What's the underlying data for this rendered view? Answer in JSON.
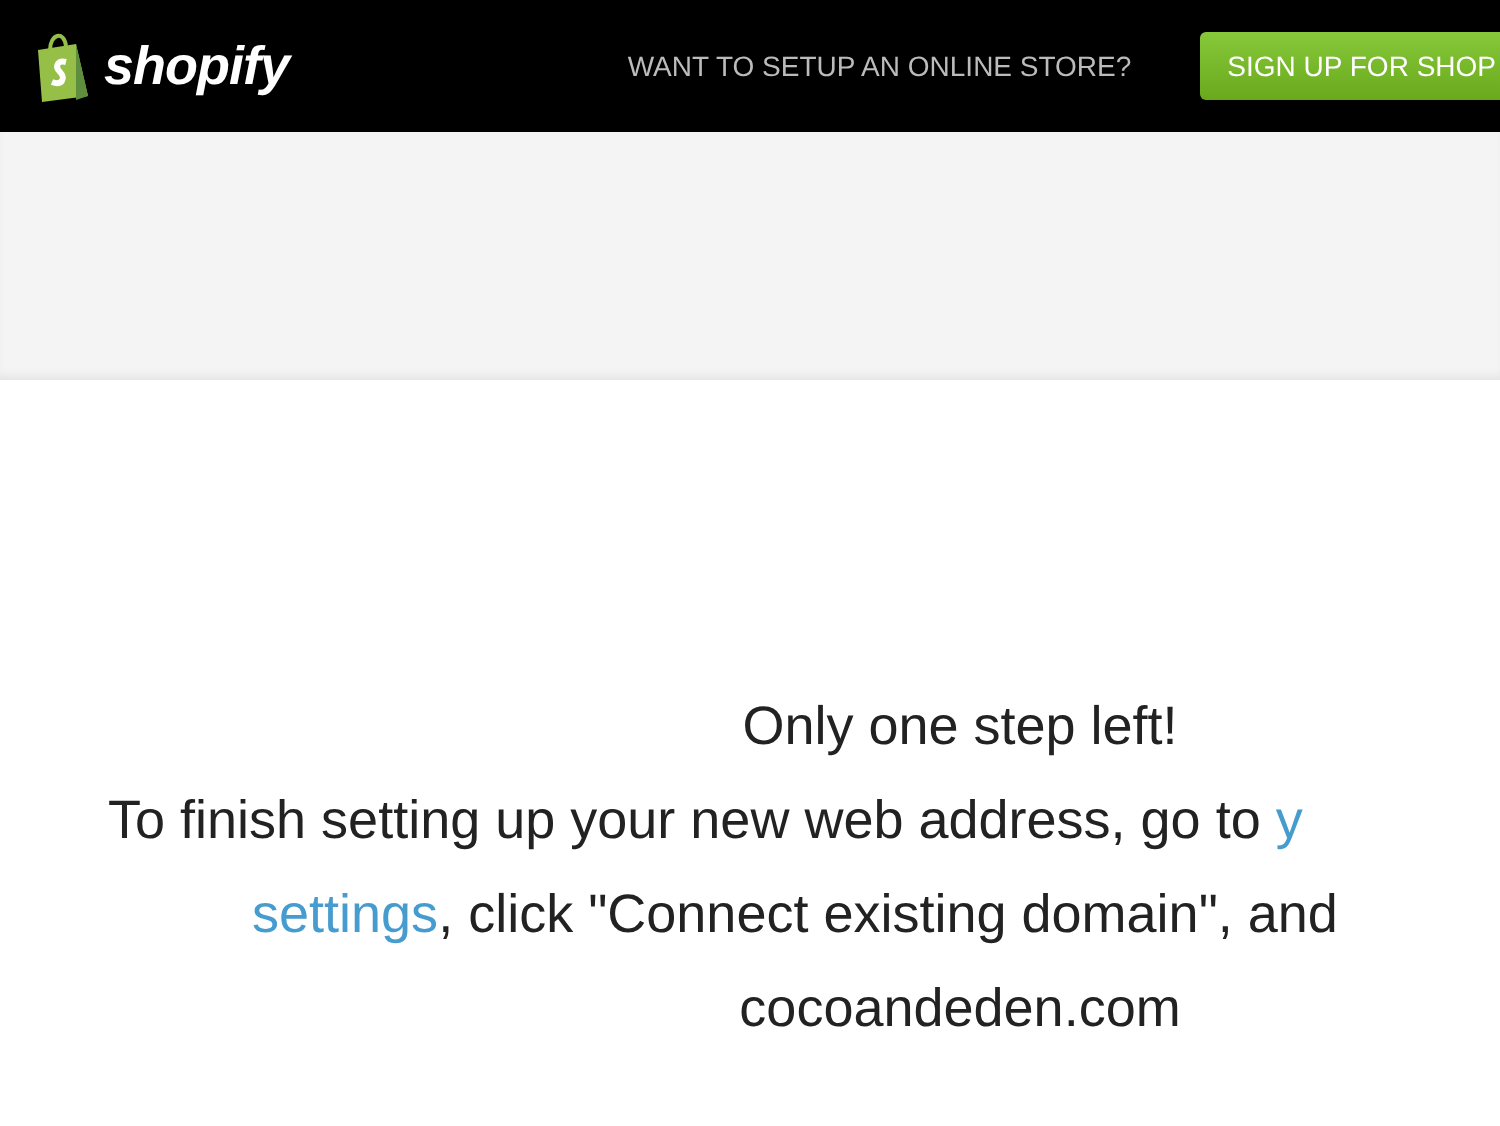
{
  "header": {
    "logo_text": "shopify",
    "prompt": "WANT TO SETUP AN ONLINE STORE?",
    "signup_button": "SIGN UP FOR SHOP"
  },
  "message": {
    "heading": "Only one step left!",
    "lines": [
      [
        {
          "kind": "text",
          "text": "To finish setting up your new web address, go to "
        },
        {
          "kind": "link",
          "text": "y"
        }
      ],
      [
        {
          "kind": "link",
          "text": "settings"
        },
        {
          "kind": "text",
          "text": ", click \"Connect existing domain\", and"
        }
      ]
    ],
    "domain": "cocoandeden.com"
  }
}
